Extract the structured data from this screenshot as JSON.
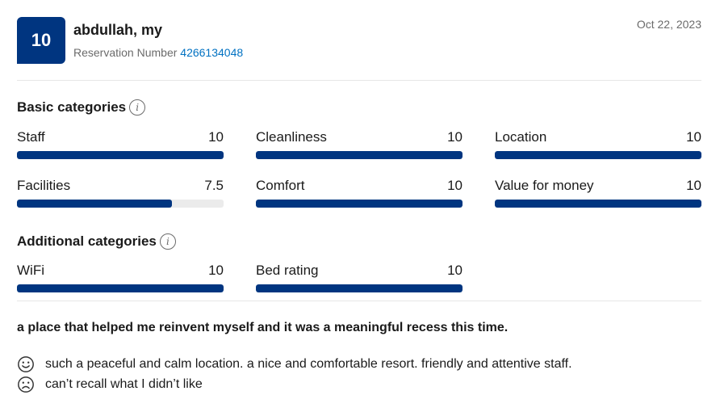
{
  "review": {
    "score": "10",
    "reviewer": "abdullah, my",
    "reservation_label": "Reservation Number",
    "reservation_number": "4266134048",
    "date": "Oct 22, 2023"
  },
  "basic": {
    "title": "Basic categories",
    "items": [
      {
        "label": "Staff",
        "value": "10",
        "fraction": 1.0
      },
      {
        "label": "Cleanliness",
        "value": "10",
        "fraction": 1.0
      },
      {
        "label": "Location",
        "value": "10",
        "fraction": 1.0
      },
      {
        "label": "Facilities",
        "value": "7.5",
        "fraction": 0.75
      },
      {
        "label": "Comfort",
        "value": "10",
        "fraction": 1.0
      },
      {
        "label": "Value for money",
        "value": "10",
        "fraction": 1.0
      }
    ]
  },
  "additional": {
    "title": "Additional categories",
    "items": [
      {
        "label": "WiFi",
        "value": "10",
        "fraction": 1.0
      },
      {
        "label": "Bed rating",
        "value": "10",
        "fraction": 1.0
      }
    ]
  },
  "text": {
    "headline": "a place that helped me reinvent myself and it was a meaningful recess this time.",
    "positive": "such a peaceful and calm location. a nice and comfortable resort. friendly and attentive staff.",
    "negative": "can’t recall what I didn’t like"
  },
  "colors": {
    "brand": "#003580",
    "link": "#0071c2",
    "track": "#ebebeb"
  },
  "icons": {
    "info": "info-icon",
    "positive": "smile-face-icon",
    "negative": "frown-face-icon"
  }
}
